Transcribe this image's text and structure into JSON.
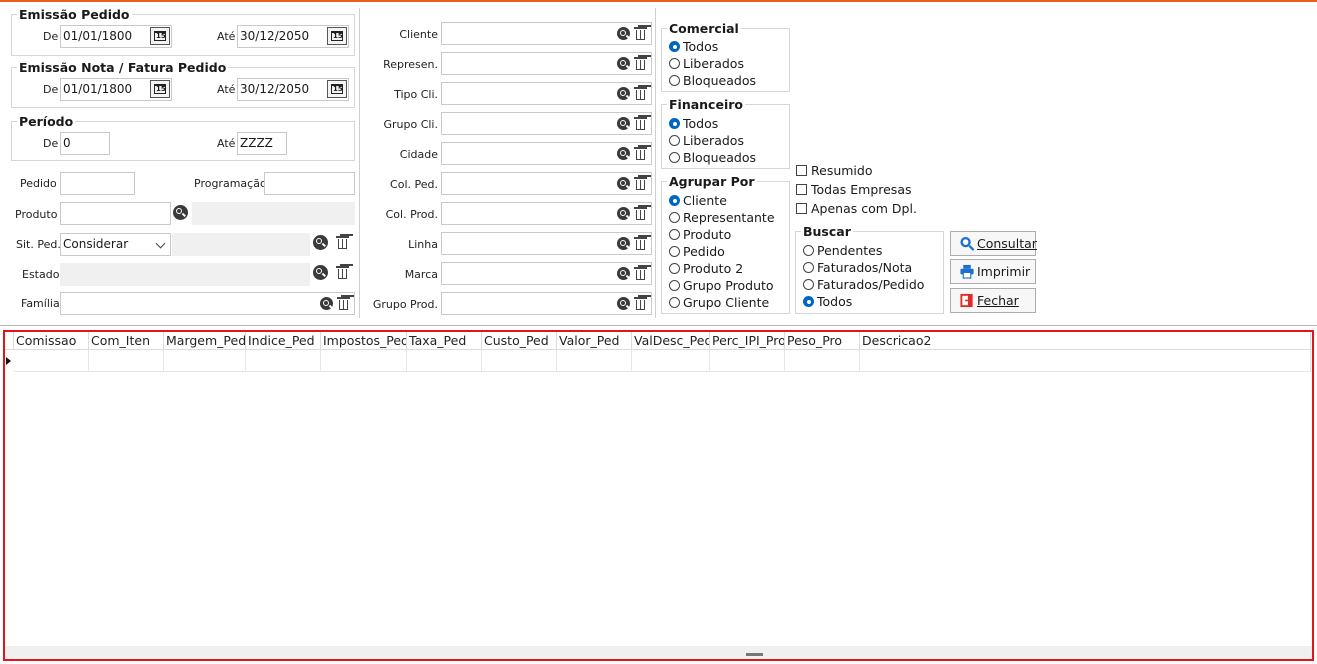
{
  "emissao_pedido": {
    "title": "Emissão Pedido",
    "de_label": "De",
    "de_value": "01/01/1800",
    "ate_label": "Até",
    "ate_value": "30/12/2050"
  },
  "emissao_nota": {
    "title": "Emissão Nota / Fatura Pedido",
    "de_label": "De",
    "de_value": "01/01/1800",
    "ate_label": "Até",
    "ate_value": "30/12/2050"
  },
  "periodo": {
    "title": "Período",
    "de_label": "De",
    "de_value": "0",
    "ate_label": "Até",
    "ate_value": "ZZZZ"
  },
  "left_fields": {
    "pedido_label": "Pedido",
    "pedido_value": "",
    "programacao_label": "Programação",
    "programacao_value": "",
    "produto_label": "Produto",
    "produto_value": "",
    "sit_ped_label": "Sit. Ped.",
    "sit_ped_value": "Considerar",
    "estado_label": "Estado",
    "familia_label": "Família"
  },
  "mid_fields": [
    {
      "label": "Cliente"
    },
    {
      "label": "Represen."
    },
    {
      "label": "Tipo Cli."
    },
    {
      "label": "Grupo Cli."
    },
    {
      "label": "Cidade"
    },
    {
      "label": "Col. Ped."
    },
    {
      "label": "Col. Prod."
    },
    {
      "label": "Linha"
    },
    {
      "label": "Marca"
    },
    {
      "label": "Grupo Prod."
    }
  ],
  "comercial": {
    "title": "Comercial",
    "options": [
      "Todos",
      "Liberados",
      "Bloqueados"
    ],
    "selected": "Todos"
  },
  "financeiro": {
    "title": "Financeiro",
    "options": [
      "Todos",
      "Liberados",
      "Bloqueados"
    ],
    "selected": "Todos"
  },
  "agrupar": {
    "title": "Agrupar Por",
    "options": [
      "Cliente",
      "Representante",
      "Produto",
      "Pedido",
      "Produto 2",
      "Grupo Produto",
      "Grupo Cliente"
    ],
    "selected": "Cliente"
  },
  "checks": [
    "Resumido",
    "Todas Empresas",
    "Apenas com Dpl."
  ],
  "buscar": {
    "title": "Buscar",
    "options": [
      "Pendentes",
      "Faturados/Nota",
      "Faturados/Pedido",
      "Todos"
    ],
    "selected": "Todos"
  },
  "buttons": {
    "consultar": "Consultar",
    "imprimir": "Imprimir",
    "fechar": "Fechar"
  },
  "grid": {
    "columns": [
      "Comissao",
      "Com_Iten",
      "Margem_Ped",
      "Indice_Ped",
      "Impostos_Ped",
      "Taxa_Ped",
      "Custo_Ped",
      "Valor_Ped",
      "ValDesc_Ped",
      "Perc_IPI_Pro",
      "Peso_Pro",
      "Descricao2"
    ]
  },
  "colors": {
    "accent": "#0067c0",
    "top_line": "#e8611a",
    "grid_border": "#e0151d"
  }
}
